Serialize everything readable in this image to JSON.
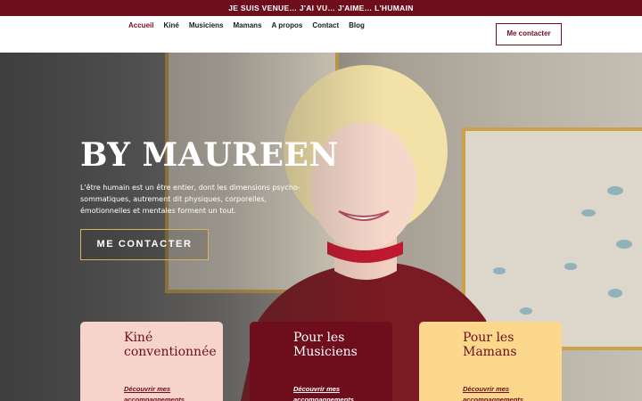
{
  "topbar": {
    "text": "JE SUIS VENUE… J'AI VU… J'AIME… L'HUMAIN"
  },
  "nav": {
    "items": [
      {
        "label": "Accueil"
      },
      {
        "label": "Kiné"
      },
      {
        "label": "Musiciens"
      },
      {
        "label": "Mamans"
      },
      {
        "label": "A propos"
      },
      {
        "label": "Contact"
      },
      {
        "label": "Blog"
      }
    ],
    "cta": "Me contacter"
  },
  "hero": {
    "title": "BY MAUREEN",
    "text": "L'être humain est un être entier, dont les dimensions psycho-sommatiques, autrement dit physiques, corporelles, émotionnelles et mentales forment un tout.",
    "cta": "ME CONTACTER"
  },
  "cards": [
    {
      "title_line1": "Kiné",
      "title_line2": "conventionnée",
      "link_line1": "Découvrir mes",
      "link_line2": "accompagnements"
    },
    {
      "title_line1": "Pour les",
      "title_line2": "Musiciens",
      "link_line1": "Découvrir mes",
      "link_line2": "accompagnements"
    },
    {
      "title_line1": "Pour les",
      "title_line2": "Mamans",
      "link_line1": "Découvrir mes",
      "link_line2": "accompagnements"
    }
  ],
  "colors": {
    "brand": "#6e0d1c",
    "gold": "#d8b25c",
    "pink": "#f6d3cb",
    "yellow": "#fbd88c"
  }
}
